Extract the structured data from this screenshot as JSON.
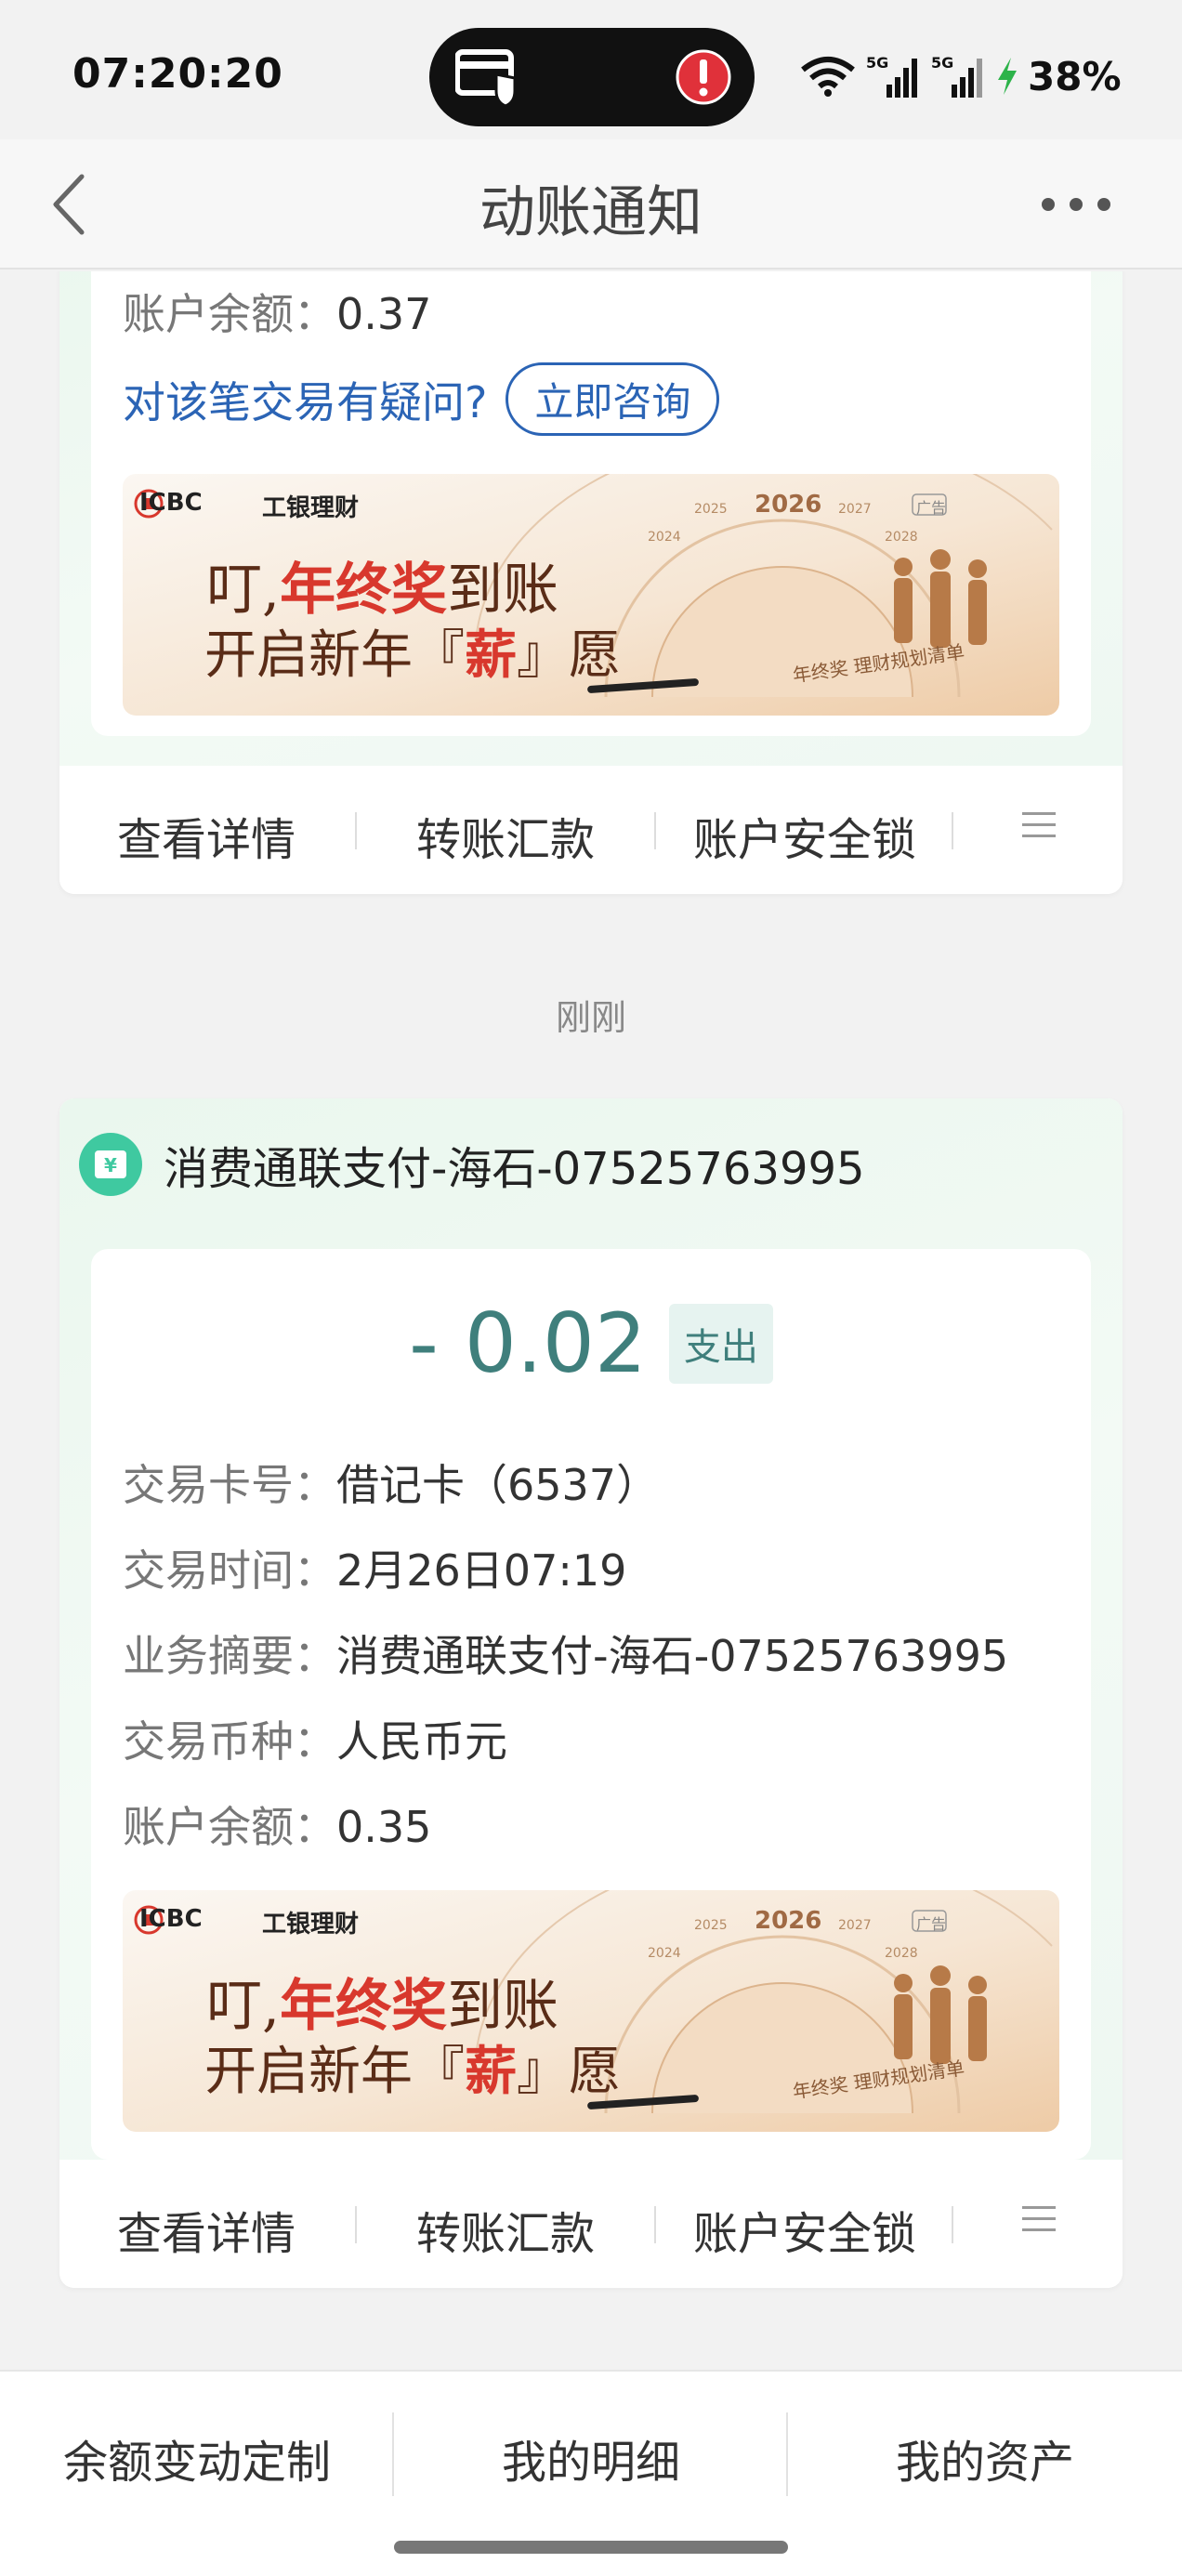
{
  "status_bar": {
    "time": "07:20:20",
    "battery": "38%",
    "signal_1": "5G",
    "signal_2": "5G"
  },
  "nav": {
    "title": "动账通知",
    "back_icon": "chevron-left-icon",
    "more_icon": "more-horizontal-icon"
  },
  "card1": {
    "balance_label": "账户余额：",
    "balance_value": "0.37",
    "doubt_text": "对该笔交易有疑问?",
    "consult_label": "立即咨询",
    "actions": [
      "查看详情",
      "转账汇款",
      "账户安全锁"
    ]
  },
  "banner": {
    "brand": "ICBC",
    "brand_sub": "工银理财",
    "ad_tag": "广告",
    "line1_a": "叮,",
    "line1_b": "年终奖",
    "line1_c": "到账",
    "line2_a": "开启新年",
    "line2_b": "薪",
    "line2_c": "愿",
    "year": "2026",
    "years_small": [
      "2024",
      "2025",
      "2027",
      "2028"
    ],
    "note": "年终奖 理财规划清单"
  },
  "timestamp": "刚刚",
  "card2": {
    "merchant": "消费通联支付-海石-07525763995",
    "amount": "- 0.02",
    "badge": "支出",
    "fields": [
      {
        "label": "交易卡号：",
        "value": "借记卡（6537）"
      },
      {
        "label": "交易时间：",
        "value": "2月26日07:19"
      },
      {
        "label": "业务摘要：",
        "value": "消费通联支付-海石-07525763995"
      },
      {
        "label": "交易币种：",
        "value": "人民币元"
      },
      {
        "label": "账户余额：",
        "value": "0.35"
      }
    ],
    "actions": [
      "查看详情",
      "转账汇款",
      "账户安全锁"
    ]
  },
  "bottom_tabs": [
    "余额变动定制",
    "我的明细",
    "我的资产"
  ],
  "colors": {
    "accent_teal": "#3f7f7c",
    "link_blue": "#2b64b5",
    "banner_red": "#d8382d"
  }
}
